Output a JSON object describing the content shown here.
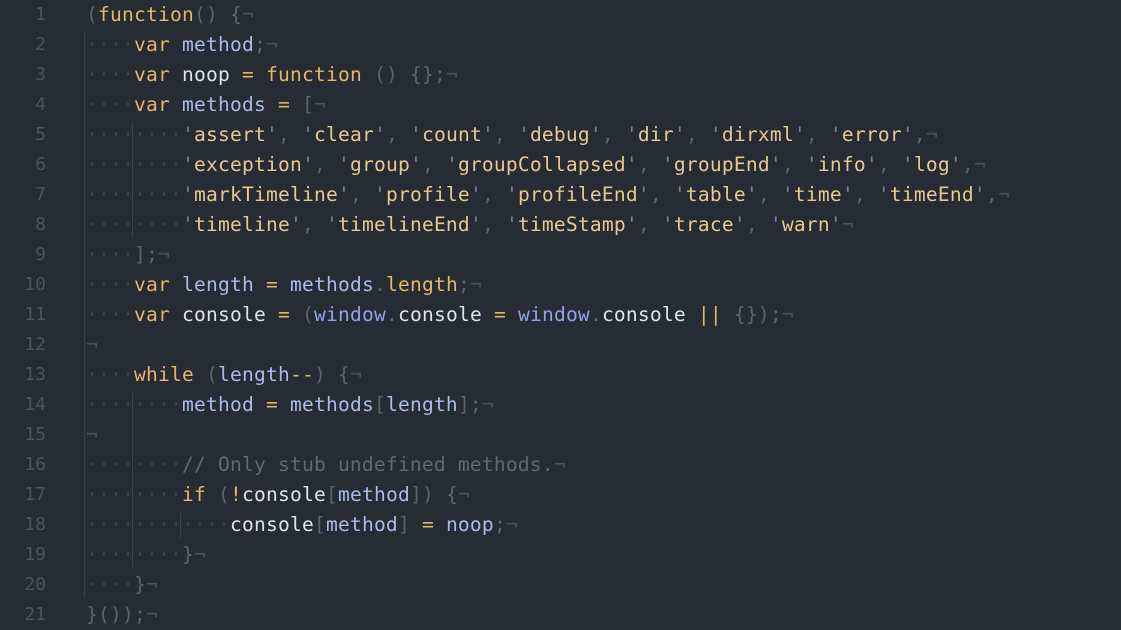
{
  "editor": {
    "language": "javascript",
    "lines": [
      {
        "number": "1",
        "indent": 0,
        "tokens": [
          [
            "pun",
            "("
          ],
          [
            "kw",
            "function"
          ],
          [
            "pun",
            "() {"
          ]
        ]
      },
      {
        "number": "2",
        "indent": 1,
        "tokens": [
          [
            "kw",
            "var"
          ],
          [
            "id",
            " "
          ],
          [
            "var",
            "method"
          ],
          [
            "pun",
            ";"
          ]
        ]
      },
      {
        "number": "3",
        "indent": 1,
        "tokens": [
          [
            "kw",
            "var"
          ],
          [
            "id",
            " "
          ],
          [
            "id",
            "noop"
          ],
          [
            "id",
            " "
          ],
          [
            "op",
            "="
          ],
          [
            "id",
            " "
          ],
          [
            "kw",
            "function"
          ],
          [
            "pun",
            " () {};"
          ]
        ]
      },
      {
        "number": "4",
        "indent": 1,
        "tokens": [
          [
            "kw",
            "var"
          ],
          [
            "id",
            " "
          ],
          [
            "var",
            "methods"
          ],
          [
            "id",
            " "
          ],
          [
            "op",
            "="
          ],
          [
            "pun",
            " ["
          ]
        ]
      },
      {
        "number": "5",
        "indent": 2,
        "tokens": [
          [
            "q",
            "'"
          ],
          [
            "str",
            "assert"
          ],
          [
            "q",
            "'"
          ],
          [
            "pun",
            ", "
          ],
          [
            "q",
            "'"
          ],
          [
            "str",
            "clear"
          ],
          [
            "q",
            "'"
          ],
          [
            "pun",
            ", "
          ],
          [
            "q",
            "'"
          ],
          [
            "str",
            "count"
          ],
          [
            "q",
            "'"
          ],
          [
            "pun",
            ", "
          ],
          [
            "q",
            "'"
          ],
          [
            "str",
            "debug"
          ],
          [
            "q",
            "'"
          ],
          [
            "pun",
            ", "
          ],
          [
            "q",
            "'"
          ],
          [
            "str",
            "dir"
          ],
          [
            "q",
            "'"
          ],
          [
            "pun",
            ", "
          ],
          [
            "q",
            "'"
          ],
          [
            "str",
            "dirxml"
          ],
          [
            "q",
            "'"
          ],
          [
            "pun",
            ", "
          ],
          [
            "q",
            "'"
          ],
          [
            "str",
            "error"
          ],
          [
            "q",
            "'"
          ],
          [
            "pun",
            ","
          ]
        ]
      },
      {
        "number": "6",
        "indent": 2,
        "tokens": [
          [
            "q",
            "'"
          ],
          [
            "str",
            "exception"
          ],
          [
            "q",
            "'"
          ],
          [
            "pun",
            ", "
          ],
          [
            "q",
            "'"
          ],
          [
            "str",
            "group"
          ],
          [
            "q",
            "'"
          ],
          [
            "pun",
            ", "
          ],
          [
            "q",
            "'"
          ],
          [
            "str",
            "groupCollapsed"
          ],
          [
            "q",
            "'"
          ],
          [
            "pun",
            ", "
          ],
          [
            "q",
            "'"
          ],
          [
            "str",
            "groupEnd"
          ],
          [
            "q",
            "'"
          ],
          [
            "pun",
            ", "
          ],
          [
            "q",
            "'"
          ],
          [
            "str",
            "info"
          ],
          [
            "q",
            "'"
          ],
          [
            "pun",
            ", "
          ],
          [
            "q",
            "'"
          ],
          [
            "str",
            "log"
          ],
          [
            "q",
            "'"
          ],
          [
            "pun",
            ","
          ]
        ]
      },
      {
        "number": "7",
        "indent": 2,
        "tokens": [
          [
            "q",
            "'"
          ],
          [
            "str",
            "markTimeline"
          ],
          [
            "q",
            "'"
          ],
          [
            "pun",
            ", "
          ],
          [
            "q",
            "'"
          ],
          [
            "str",
            "profile"
          ],
          [
            "q",
            "'"
          ],
          [
            "pun",
            ", "
          ],
          [
            "q",
            "'"
          ],
          [
            "str",
            "profileEnd"
          ],
          [
            "q",
            "'"
          ],
          [
            "pun",
            ", "
          ],
          [
            "q",
            "'"
          ],
          [
            "str",
            "table"
          ],
          [
            "q",
            "'"
          ],
          [
            "pun",
            ", "
          ],
          [
            "q",
            "'"
          ],
          [
            "str",
            "time"
          ],
          [
            "q",
            "'"
          ],
          [
            "pun",
            ", "
          ],
          [
            "q",
            "'"
          ],
          [
            "str",
            "timeEnd"
          ],
          [
            "q",
            "'"
          ],
          [
            "pun",
            ","
          ]
        ]
      },
      {
        "number": "8",
        "indent": 2,
        "tokens": [
          [
            "q",
            "'"
          ],
          [
            "str",
            "timeline"
          ],
          [
            "q",
            "'"
          ],
          [
            "pun",
            ", "
          ],
          [
            "q",
            "'"
          ],
          [
            "str",
            "timelineEnd"
          ],
          [
            "q",
            "'"
          ],
          [
            "pun",
            ", "
          ],
          [
            "q",
            "'"
          ],
          [
            "str",
            "timeStamp"
          ],
          [
            "q",
            "'"
          ],
          [
            "pun",
            ", "
          ],
          [
            "q",
            "'"
          ],
          [
            "str",
            "trace"
          ],
          [
            "q",
            "'"
          ],
          [
            "pun",
            ", "
          ],
          [
            "q",
            "'"
          ],
          [
            "str",
            "warn"
          ],
          [
            "q",
            "'"
          ]
        ]
      },
      {
        "number": "9",
        "indent": 1,
        "tokens": [
          [
            "pun",
            "];"
          ]
        ]
      },
      {
        "number": "10",
        "indent": 1,
        "tokens": [
          [
            "kw",
            "var"
          ],
          [
            "id",
            " "
          ],
          [
            "var",
            "length"
          ],
          [
            "id",
            " "
          ],
          [
            "op",
            "="
          ],
          [
            "id",
            " "
          ],
          [
            "var",
            "methods"
          ],
          [
            "pun",
            "."
          ],
          [
            "kw",
            "length"
          ],
          [
            "pun",
            ";"
          ]
        ]
      },
      {
        "number": "11",
        "indent": 1,
        "tokens": [
          [
            "kw",
            "var"
          ],
          [
            "id",
            " "
          ],
          [
            "id",
            "console"
          ],
          [
            "id",
            " "
          ],
          [
            "op",
            "="
          ],
          [
            "pun",
            " ("
          ],
          [
            "glob",
            "window"
          ],
          [
            "pun",
            "."
          ],
          [
            "id",
            "console"
          ],
          [
            "id",
            " "
          ],
          [
            "op",
            "="
          ],
          [
            "id",
            " "
          ],
          [
            "glob",
            "window"
          ],
          [
            "pun",
            "."
          ],
          [
            "id",
            "console"
          ],
          [
            "id",
            " "
          ],
          [
            "op",
            "||"
          ],
          [
            "pun",
            " {});"
          ]
        ]
      },
      {
        "number": "12",
        "indent": 0,
        "tokens": []
      },
      {
        "number": "13",
        "indent": 1,
        "tokens": [
          [
            "kw",
            "while"
          ],
          [
            "pun",
            " ("
          ],
          [
            "var",
            "length"
          ],
          [
            "op",
            "--"
          ],
          [
            "pun",
            ") {"
          ]
        ]
      },
      {
        "number": "14",
        "indent": 2,
        "tokens": [
          [
            "var",
            "method"
          ],
          [
            "id",
            " "
          ],
          [
            "op",
            "="
          ],
          [
            "id",
            " "
          ],
          [
            "var",
            "methods"
          ],
          [
            "pun",
            "["
          ],
          [
            "var",
            "length"
          ],
          [
            "pun",
            "];"
          ]
        ]
      },
      {
        "number": "15",
        "indent": 0,
        "tokens": []
      },
      {
        "number": "16",
        "indent": 2,
        "tokens": [
          [
            "cm",
            "// Only stub undefined methods."
          ]
        ]
      },
      {
        "number": "17",
        "indent": 2,
        "tokens": [
          [
            "kw",
            "if"
          ],
          [
            "pun",
            " ("
          ],
          [
            "op",
            "!"
          ],
          [
            "id",
            "console"
          ],
          [
            "pun",
            "["
          ],
          [
            "var",
            "method"
          ],
          [
            "pun",
            "]) {"
          ]
        ]
      },
      {
        "number": "18",
        "indent": 3,
        "tokens": [
          [
            "id",
            "console"
          ],
          [
            "pun",
            "["
          ],
          [
            "var",
            "method"
          ],
          [
            "pun",
            "]"
          ],
          [
            "id",
            " "
          ],
          [
            "op",
            "="
          ],
          [
            "id",
            " "
          ],
          [
            "var",
            "noop"
          ],
          [
            "pun",
            ";"
          ]
        ]
      },
      {
        "number": "19",
        "indent": 2,
        "tokens": [
          [
            "pun",
            "}"
          ]
        ]
      },
      {
        "number": "20",
        "indent": 1,
        "tokens": [
          [
            "pun",
            "}"
          ]
        ]
      },
      {
        "number": "21",
        "indent": 0,
        "tokens": [
          [
            "pun",
            "}());"
          ]
        ]
      }
    ],
    "invisibles": {
      "eol": "¬",
      "space": "·"
    },
    "colors": {
      "background": "#272b33",
      "keyword": "#e2b866",
      "variable": "#abbaeb",
      "string": "#e5c98f",
      "comment": "#5f6778",
      "line_number": "#4b5263"
    }
  }
}
